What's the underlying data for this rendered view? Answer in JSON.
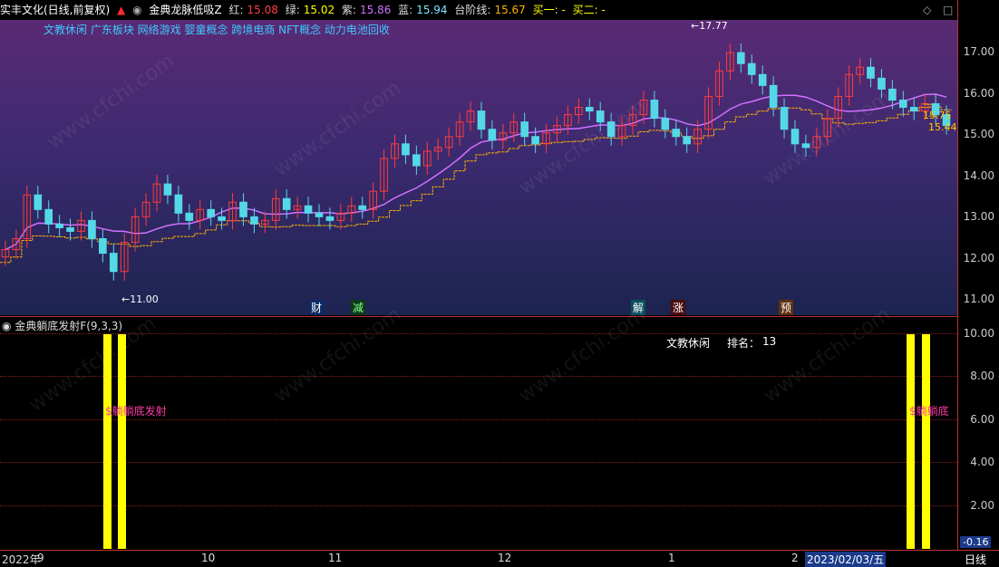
{
  "header": {
    "stock_name": "实丰文化(日线,前复权)",
    "indicator_name": "金典龙脉低吸Z",
    "red_label": "红:",
    "red_value": "15.08",
    "green_label": "绿:",
    "green_value": "15.02",
    "purple_label": "紫:",
    "purple_value": "15.86",
    "blue_label": "蓝:",
    "blue_value": "15.94",
    "stage_label": "台阶线:",
    "stage_value": "15.67",
    "buy1": "买一: -",
    "buy2": "买二: -"
  },
  "concepts": "文教休闲 广东板块 网络游戏 婴童概念 跨境电商 NFT概念 动力电池回收",
  "main_axis": [
    "17.00",
    "16.00",
    "15.00",
    "14.00",
    "13.00",
    "12.00",
    "11.00"
  ],
  "price_marks": {
    "high": "17.77",
    "low": "11.00",
    "last1": "15.75",
    "last2": "15.44"
  },
  "badges": [
    "财",
    "减",
    "解",
    "涨",
    "预"
  ],
  "sub_title": "金典躺底发射F(9,3,3)",
  "sub_info": {
    "name": "文教休闲",
    "rank_label": "排名：",
    "rank_value": "13"
  },
  "sub_axis": [
    "10.00",
    "8.00",
    "6.00",
    "4.00",
    "2.00"
  ],
  "sub_bottom": "-0.16",
  "signal_text_left": "$躺躺底发射",
  "signal_text_right": "$躺躺底",
  "x_axis": [
    "2022年",
    "9",
    "10",
    "11",
    "12",
    "1",
    "2"
  ],
  "date_highlight": "2023/02/03/五",
  "period_label": "日线",
  "watermark": "www.cfchi.com",
  "colors": {
    "up": "#ff3b3b",
    "down": "#54d8e8",
    "yellow": "#ffff00",
    "magenta": "#ff00ff",
    "accent": "#ffcc00"
  },
  "chart_data": {
    "type": "candlestick",
    "x": [
      "2022年",
      "9",
      "10",
      "11",
      "12",
      "1",
      "2"
    ],
    "ylim": [
      10.7,
      17.9
    ],
    "closes": [
      12.1,
      12.4,
      13.6,
      13.2,
      12.8,
      12.7,
      12.6,
      12.9,
      12.4,
      12.0,
      11.5,
      12.3,
      13.0,
      13.4,
      13.9,
      13.6,
      13.1,
      12.9,
      13.2,
      13.0,
      12.9,
      13.4,
      13.0,
      12.8,
      12.9,
      13.5,
      13.2,
      13.3,
      13.1,
      13.0,
      12.9,
      13.1,
      13.3,
      13.2,
      13.7,
      14.6,
      15.0,
      14.7,
      14.4,
      14.8,
      14.9,
      15.2,
      15.6,
      15.9,
      15.4,
      15.1,
      15.3,
      15.6,
      15.2,
      15.0,
      15.3,
      15.5,
      15.8,
      16.0,
      15.9,
      15.6,
      15.2,
      15.5,
      15.8,
      16.2,
      15.7,
      15.4,
      15.2,
      15.0,
      15.4,
      16.3,
      17.0,
      17.5,
      17.2,
      16.9,
      16.6,
      16.0,
      15.4,
      15.0,
      14.9,
      15.2,
      15.7,
      16.3,
      16.9,
      17.1,
      16.8,
      16.5,
      16.2,
      16.0,
      15.9,
      16.1,
      15.8,
      15.5
    ]
  }
}
